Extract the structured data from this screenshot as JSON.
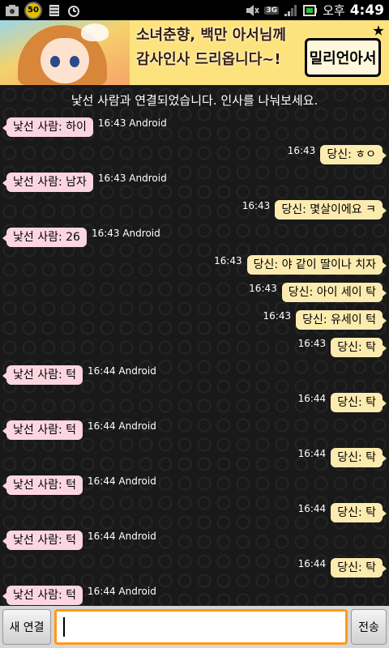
{
  "status_bar": {
    "battery_level_badge": "50",
    "network_type": "3G",
    "ampm": "오후",
    "time": "4:49",
    "icons": [
      "image-icon",
      "battery-badge-icon",
      "sd-card-icon",
      "alarm-icon",
      "mute-icon",
      "network-3g-icon",
      "signal-icon",
      "battery-icon"
    ]
  },
  "banner": {
    "headline_line1": "소녀춘향, 백만 아서님께",
    "headline_line2": "감사인사 드리옵니다~!",
    "logo_text": "밀리언아서"
  },
  "chat": {
    "notice": "낯선 사람과 연결되었습니다. 인사를 나눠보세요.",
    "messages": [
      {
        "sender": "stranger",
        "text": "낯선 사람: 하이",
        "meta": "16:43 Android"
      },
      {
        "sender": "me",
        "text": "당신: ㅎㅇ",
        "meta": "16:43"
      },
      {
        "sender": "stranger",
        "text": "낯선 사람: 남자",
        "meta": "16:43 Android"
      },
      {
        "sender": "me",
        "text": "당신: 몇살이에요 ㅋ",
        "meta": "16:43"
      },
      {
        "sender": "stranger",
        "text": "낯선 사람: 26",
        "meta": "16:43 Android"
      },
      {
        "sender": "me",
        "text": "당신: 야 같이 딸이나 치자",
        "meta": "16:43"
      },
      {
        "sender": "me",
        "text": "당신: 아이 세이 탁",
        "meta": "16:43"
      },
      {
        "sender": "me",
        "text": "당신: 유세이 턱",
        "meta": "16:43"
      },
      {
        "sender": "me",
        "text": "당신: 탁",
        "meta": "16:43"
      },
      {
        "sender": "stranger",
        "text": "낯선 사람: 턱",
        "meta": "16:44 Android"
      },
      {
        "sender": "me",
        "text": "당신: 탁",
        "meta": "16:44"
      },
      {
        "sender": "stranger",
        "text": "낯선 사람: 턱",
        "meta": "16:44 Android"
      },
      {
        "sender": "me",
        "text": "당신: 탁",
        "meta": "16:44"
      },
      {
        "sender": "stranger",
        "text": "낯선 사람: 턱",
        "meta": "16:44 Android"
      },
      {
        "sender": "me",
        "text": "당신: 탁",
        "meta": "16:44"
      },
      {
        "sender": "stranger",
        "text": "낯선 사람: 턱",
        "meta": "16:44 Android"
      },
      {
        "sender": "me",
        "text": "당신: 탁",
        "meta": "16:44"
      },
      {
        "sender": "stranger",
        "text": "낯선 사람: 턱",
        "meta": "16:44 Android"
      }
    ]
  },
  "bottom_bar": {
    "new_connection_label": "새 연결",
    "input_value": "",
    "send_label": "전송"
  },
  "colors": {
    "stranger_bubble": "#fbd6e1",
    "my_bubble": "#fbebaf",
    "input_focus_border": "#ff9a1a",
    "banner_bg": "#fde37e"
  }
}
